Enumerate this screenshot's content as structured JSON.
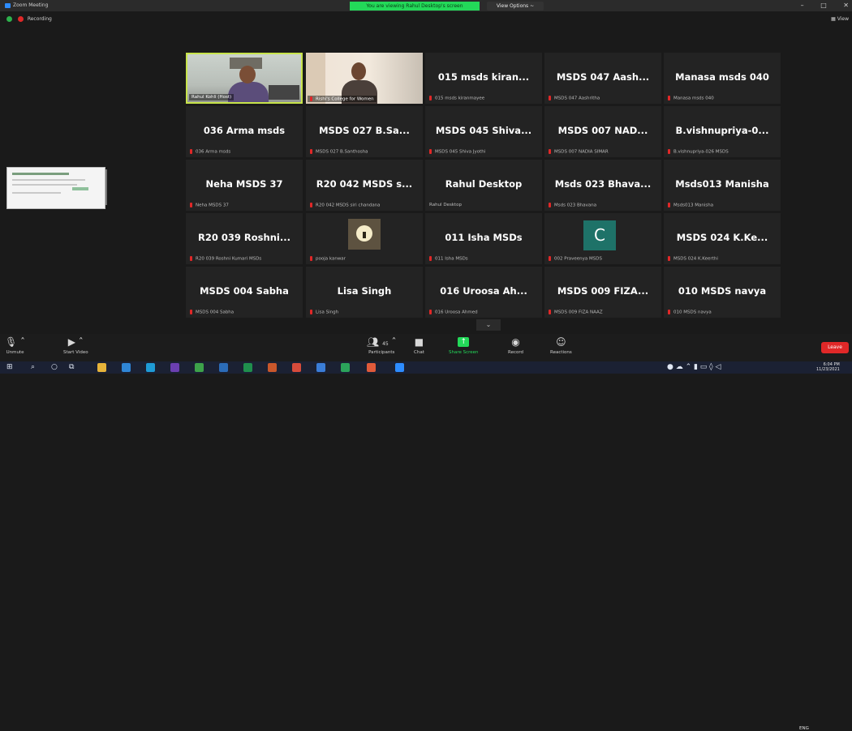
{
  "window": {
    "title": "Zoom Meeting",
    "share_banner": "You are viewing Rahul Desktop's screen",
    "view_options": "View Options ~",
    "minimize": "–",
    "maximize": "□",
    "close": "✕"
  },
  "status": {
    "recording": "Recording",
    "view_button": "View"
  },
  "participants": [
    {
      "display": "",
      "tag": "Rahul Kohli (Host)",
      "video": true
    },
    {
      "display": "",
      "tag": "Rishi's College for Women",
      "video": true
    },
    {
      "display": "015 msds kiran...",
      "tag": "015 msds kiranmayee"
    },
    {
      "display": "MSDS 047 Aash...",
      "tag": "MSDS 047 Aashritha"
    },
    {
      "display": "Manasa msds 040",
      "tag": "Manasa msds 040"
    },
    {
      "display": "036 Arma msds",
      "tag": "036 Arma msds"
    },
    {
      "display": "MSDS 027 B.Sa...",
      "tag": "MSDS 027 B.Santhosha"
    },
    {
      "display": "MSDS 045 Shiva...",
      "tag": "MSDS 045 Shiva Jyothi"
    },
    {
      "display": "MSDS 007 NAD...",
      "tag": "MSDS 007 NADIA SIMAR"
    },
    {
      "display": "B.vishnupriya-0...",
      "tag": "B.vishnupriya-026 MSDS"
    },
    {
      "display": "Neha MSDS 37",
      "tag": "Neha MSDS 37"
    },
    {
      "display": "R20 042 MSDS s...",
      "tag": "R20 042 MSDS siri chandana"
    },
    {
      "display": "Rahul Desktop",
      "tag": "Rahul Desktop"
    },
    {
      "display": "Msds 023 Bhava...",
      "tag": "Msds 023 Bhavana"
    },
    {
      "display": "Msds013 Manisha",
      "tag": "Msds013 Manisha"
    },
    {
      "display": "R20 039 Roshni...",
      "tag": "R20 039 Roshni Kumari MSDs"
    },
    {
      "display": "",
      "tag": "pooja kanwar",
      "avatar": "picture"
    },
    {
      "display": "011 Isha MSDs",
      "tag": "011 Isha MSDs"
    },
    {
      "display": "",
      "tag": "002 Praveenya MSDS",
      "avatar": "C"
    },
    {
      "display": "MSDS 024 K.Ke...",
      "tag": "MSDS 024 K.Keerthi"
    },
    {
      "display": "MSDS 004 Sabha",
      "tag": "MSDS 004 Sabha"
    },
    {
      "display": "Lisa Singh",
      "tag": "Lisa Singh"
    },
    {
      "display": "016 Uroosa Ah...",
      "tag": "016 Uroosa Ahmed"
    },
    {
      "display": "MSDS 009 FIZA...",
      "tag": "MSDS 009 FIZA NAAZ"
    },
    {
      "display": "010 MSDS navya",
      "tag": "010 MSDS navya"
    }
  ],
  "toolbar": {
    "unmute": "Unmute",
    "start_video": "Start Video",
    "participants": "Participants",
    "participant_count": "45",
    "chat": "Chat",
    "share_screen": "Share Screen",
    "record": "Record",
    "reactions": "Reactions",
    "leave": "Leave"
  },
  "taskbar": {
    "lang": "ENG",
    "time": "6:04 PM",
    "date": "11/23/2021"
  }
}
